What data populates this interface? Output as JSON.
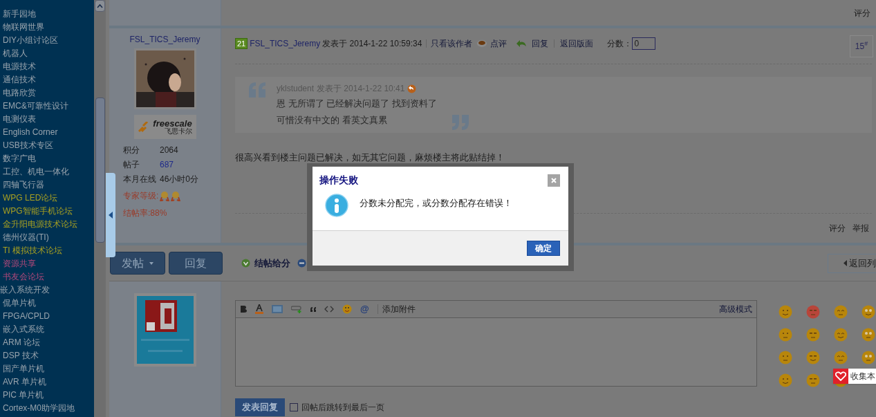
{
  "sidebar": {
    "items": [
      {
        "label": "新手园地",
        "kind": "forum"
      },
      {
        "label": "物联网世界",
        "kind": "forum"
      },
      {
        "label": "DIY小组讨论区",
        "kind": "forum"
      },
      {
        "label": "机器人",
        "kind": "forum"
      },
      {
        "label": "电源技术",
        "kind": "forum"
      },
      {
        "label": "通信技术",
        "kind": "forum"
      },
      {
        "label": "电路欣赏",
        "kind": "forum"
      },
      {
        "label": "EMC&可靠性设计",
        "kind": "forum"
      },
      {
        "label": "电测仪表",
        "kind": "forum"
      },
      {
        "label": "English Corner",
        "kind": "forum"
      },
      {
        "label": "USB技术专区",
        "kind": "forum"
      },
      {
        "label": "数字广电",
        "kind": "forum"
      },
      {
        "label": "工控、机电一体化",
        "kind": "forum"
      },
      {
        "label": "四轴飞行器",
        "kind": "forum"
      },
      {
        "label": "WPG LED论坛",
        "kind": "sponsor"
      },
      {
        "label": "WPG智能手机论坛",
        "kind": "sponsor"
      },
      {
        "label": "金升阳电源技术论坛",
        "kind": "sponsor"
      },
      {
        "label": "德州仪器(TI)",
        "kind": "forum"
      },
      {
        "label": "TI 模拟技术论坛",
        "kind": "sponsor"
      },
      {
        "label": "资源共享",
        "kind": "featured"
      },
      {
        "label": "书友会论坛",
        "kind": "featured"
      },
      {
        "label": "嵌入系统开发",
        "kind": "category"
      },
      {
        "label": "侃单片机",
        "kind": "forum"
      },
      {
        "label": "FPGA/CPLD",
        "kind": "forum"
      },
      {
        "label": "嵌入式系统",
        "kind": "forum"
      },
      {
        "label": "ARM 论坛",
        "kind": "forum"
      },
      {
        "label": "DSP 技术",
        "kind": "forum"
      },
      {
        "label": "国产单片机",
        "kind": "forum"
      },
      {
        "label": "AVR 单片机",
        "kind": "forum"
      },
      {
        "label": "PIC 单片机",
        "kind": "forum"
      },
      {
        "label": "Cortex-M0助学园地",
        "kind": "forum"
      }
    ]
  },
  "top_links": [
    "评分"
  ],
  "post": {
    "user": {
      "name": "FSL_TICS_Jeremy",
      "sponsor_logo": "freescale",
      "sponsor_sub": "飞思卡尔",
      "stats": [
        {
          "label": "积分",
          "value": "2064",
          "kind": "text"
        },
        {
          "label": "帖子",
          "value": "687",
          "kind": "link"
        },
        {
          "label": "本月在线",
          "value": "46小时0分",
          "kind": "text"
        }
      ],
      "expert_label": "专家等级:",
      "close_rate": "结帖率:88%"
    },
    "badge": "21",
    "author": "FSL_TICS_Jeremy",
    "posted": "发表于 2014-1-22 10:59:34",
    "only_author": "只看该作者",
    "comment": "点评",
    "reply": "回复",
    "back": "返回版面",
    "score_label": "分数：",
    "score_value": "0",
    "floor": "15",
    "floor_mark": "#",
    "quote": {
      "author": "yklstudent",
      "posted": "发表于 2014-1-22 10:41",
      "lines": [
        "恩 无所谓了 已经解决问题了 找到资料了",
        "可惜没有中文的 看英文真累"
      ]
    },
    "body": "很高兴看到楼主问题已解决，如无其它问题，麻烦楼主将此贴结掉！",
    "footer_links": [
      "评分",
      "举报"
    ]
  },
  "actions": {
    "new_post": "发帖",
    "reply": "回复",
    "close_reward": "结帖给分",
    "back_list": "返回列"
  },
  "editor": {
    "mention": "@",
    "attach": "添加附件",
    "advanced": "高级模式",
    "submit": "发表回复",
    "jump": {
      "label": "回帖后跳转到最后一页",
      "checked": false
    }
  },
  "collect": "收集本",
  "dialog": {
    "title": "操作失败",
    "message": "分数未分配完，或分数分配存在错误！",
    "ok": "确定"
  }
}
